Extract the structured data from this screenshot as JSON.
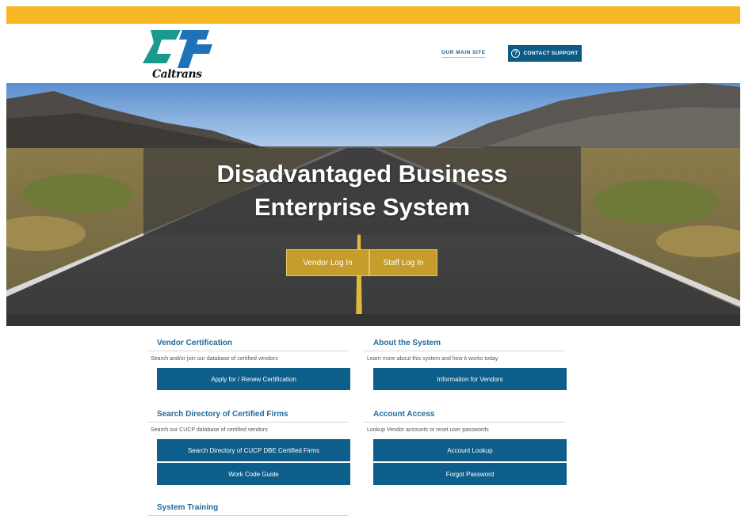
{
  "header": {
    "logo_text": "Caltrans",
    "main_site_link": "OUR MAIN SITE",
    "support_button": "CONTACT SUPPORT",
    "support_icon": "?"
  },
  "colors": {
    "topbar": "#f5b722",
    "primary_blue": "#0d5e8a",
    "gold_button": "#c69c2b",
    "section_title": "#1f6a9c",
    "logo_teal": "#1a9a8c",
    "logo_blue": "#1e72b8"
  },
  "hero": {
    "title_line1": "Disadvantaged Business",
    "title_line2": "Enterprise System",
    "vendor_login": "Vendor Log In",
    "staff_login": "Staff Log In"
  },
  "sections": {
    "vendor_certification": {
      "title": "Vendor Certification",
      "desc": "Search and/or join our database of certified vendors",
      "button": "Apply for / Renew Certification"
    },
    "about": {
      "title": "About the System",
      "desc": "Learn more about this system and how it works today",
      "button": "Information for Vendors"
    },
    "directory": {
      "title": "Search Directory of Certified Firms",
      "desc": "Search our CUCP database of certified vendors",
      "button1": "Search Directory of CUCP DBE Certified Firms",
      "button2": "Work Code Guide"
    },
    "account": {
      "title": "Account Access",
      "desc": "Lookup Vendor accounts or reset user passwords",
      "button1": "Account Lookup",
      "button2": "Forgot Password"
    },
    "training": {
      "title": "System Training"
    }
  }
}
